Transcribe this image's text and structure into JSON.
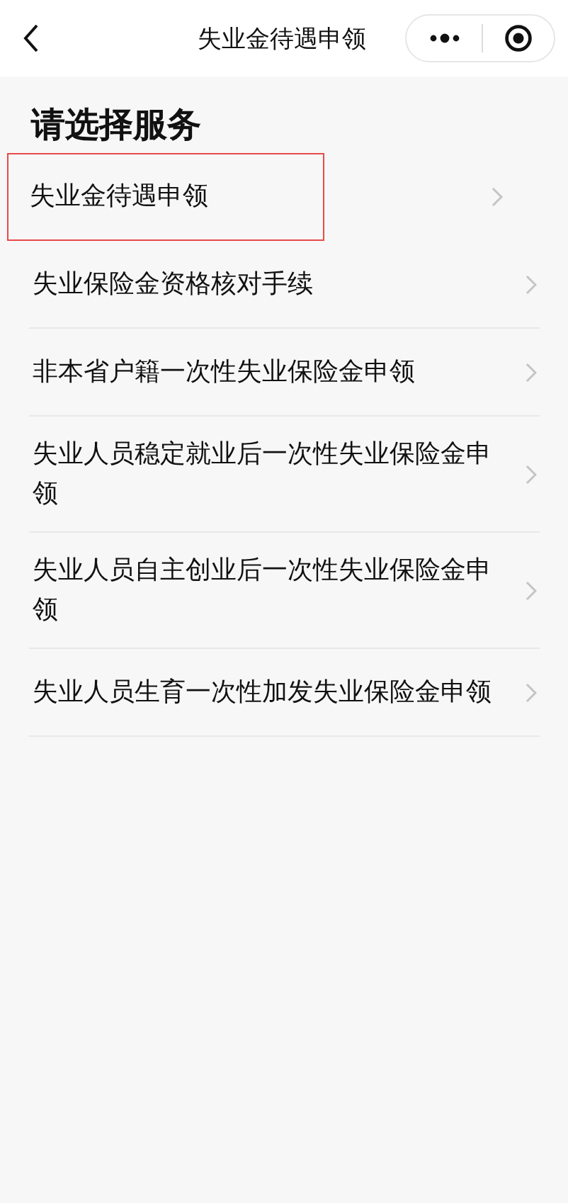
{
  "nav_bar": {
    "title": "失业金待遇申领"
  },
  "heading": "请选择服务",
  "services": [
    {
      "label": "失业金待遇申领",
      "highlighted": true
    },
    {
      "label": "失业保险金资格核对手续",
      "highlighted": false
    },
    {
      "label": "非本省户籍一次性失业保险金申领",
      "highlighted": false
    },
    {
      "label": "失业人员稳定就业后一次性失业保险金申领",
      "highlighted": false
    },
    {
      "label": "失业人员自主创业后一次性失业保险金申领",
      "highlighted": false
    },
    {
      "label": "失业人员生育一次性加发失业保险金申领",
      "highlighted": false
    }
  ]
}
